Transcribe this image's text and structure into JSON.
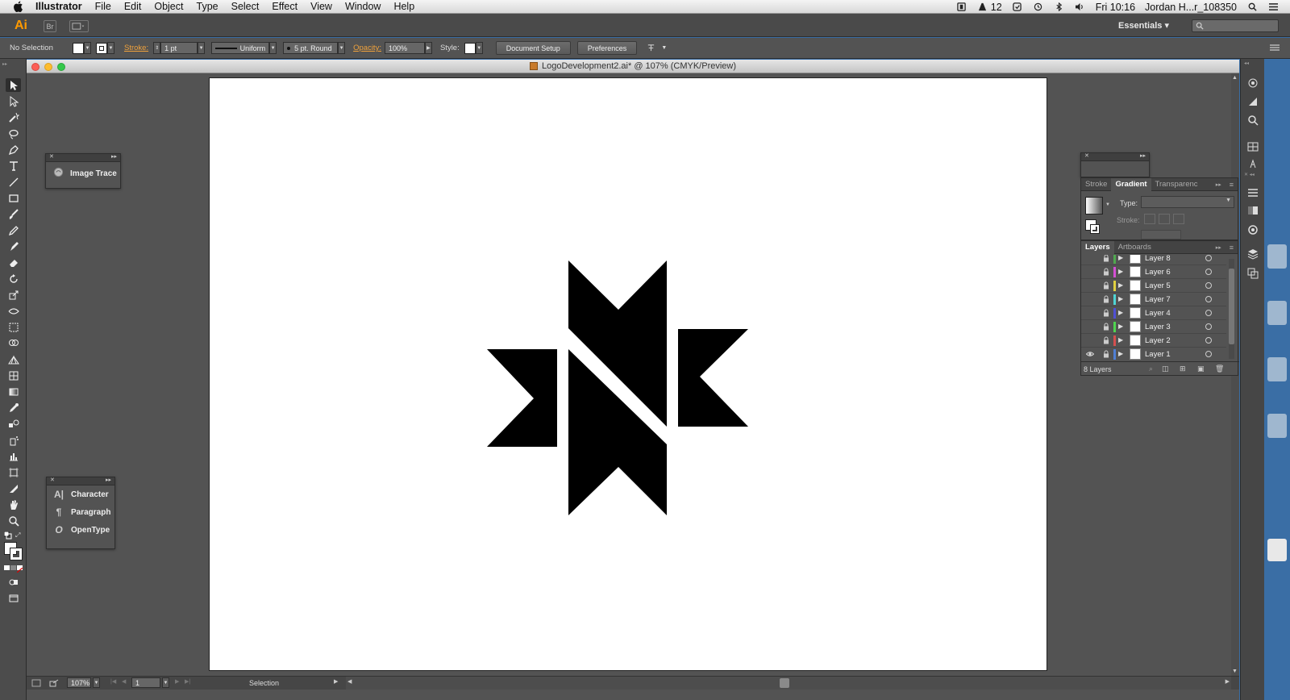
{
  "menubar": {
    "app_name": "Illustrator",
    "items": [
      "File",
      "Edit",
      "Object",
      "Type",
      "Select",
      "Effect",
      "View",
      "Window",
      "Help"
    ],
    "status_count": "12",
    "clock": "Fri 10:16",
    "user": "Jordan H...r_108350"
  },
  "appbar": {
    "logo": "Ai",
    "bridge_label": "Br",
    "workspace": "Essentials"
  },
  "controlbar": {
    "selection": "No Selection",
    "stroke_label": "Stroke:",
    "stroke_weight": "1 pt",
    "profile": "Uniform",
    "brush": "5 pt. Round",
    "opacity_label": "Opacity:",
    "opacity_value": "100%",
    "style_label": "Style:",
    "document_setup": "Document Setup",
    "preferences": "Preferences"
  },
  "document": {
    "title": "LogoDevelopment2.ai* @ 107% (CMYK/Preview)",
    "zoom": "107%",
    "artboard_number": "1",
    "status_tool": "Selection"
  },
  "panels": {
    "image_trace": "Image Trace",
    "type_items": [
      "Character",
      "Paragraph",
      "OpenType"
    ]
  },
  "gradient_panel": {
    "tabs": [
      "Stroke",
      "Gradient",
      "Transparenc"
    ],
    "type_label": "Type:",
    "stroke_label": "Stroke:"
  },
  "layers_panel": {
    "tabs": [
      "Layers",
      "Artboards"
    ],
    "layers": [
      {
        "name": "Layer 8",
        "color": "#4fa84f",
        "visible": false
      },
      {
        "name": "Layer 6",
        "color": "#d44fd4",
        "visible": false
      },
      {
        "name": "Layer 5",
        "color": "#e0d040",
        "visible": false
      },
      {
        "name": "Layer 7",
        "color": "#4fd4d4",
        "visible": false
      },
      {
        "name": "Layer 4",
        "color": "#4f4fd4",
        "visible": false
      },
      {
        "name": "Layer 3",
        "color": "#4fd44f",
        "visible": false
      },
      {
        "name": "Layer 2",
        "color": "#d44f4f",
        "visible": false
      },
      {
        "name": "Layer 1",
        "color": "#4f7fd4",
        "visible": true
      }
    ],
    "count": "8 Layers"
  }
}
